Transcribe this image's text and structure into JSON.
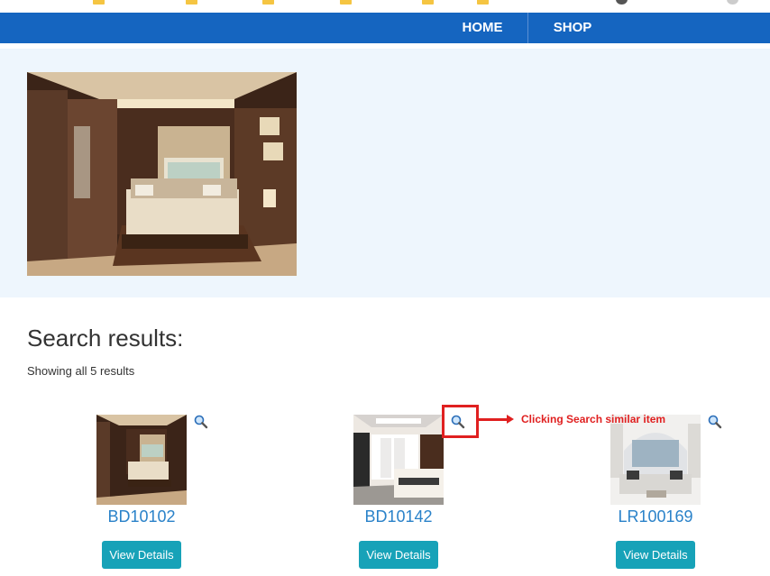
{
  "nav": {
    "home": "HOME",
    "shop": "SHOP"
  },
  "search": {
    "title": "Search results:",
    "count": "Showing all 5 results"
  },
  "products": [
    {
      "code": "BD10102",
      "button": "View Details"
    },
    {
      "code": "BD10142",
      "button": "View Details"
    },
    {
      "code": "LR100169",
      "button": "View Details"
    }
  ],
  "annotation": {
    "text": "Clicking Search similar item",
    "color": "#e02020"
  },
  "colors": {
    "nav": "#1565c0",
    "hero_bg": "#eef6fd",
    "link": "#2a82c9",
    "button": "#17a2b8"
  }
}
